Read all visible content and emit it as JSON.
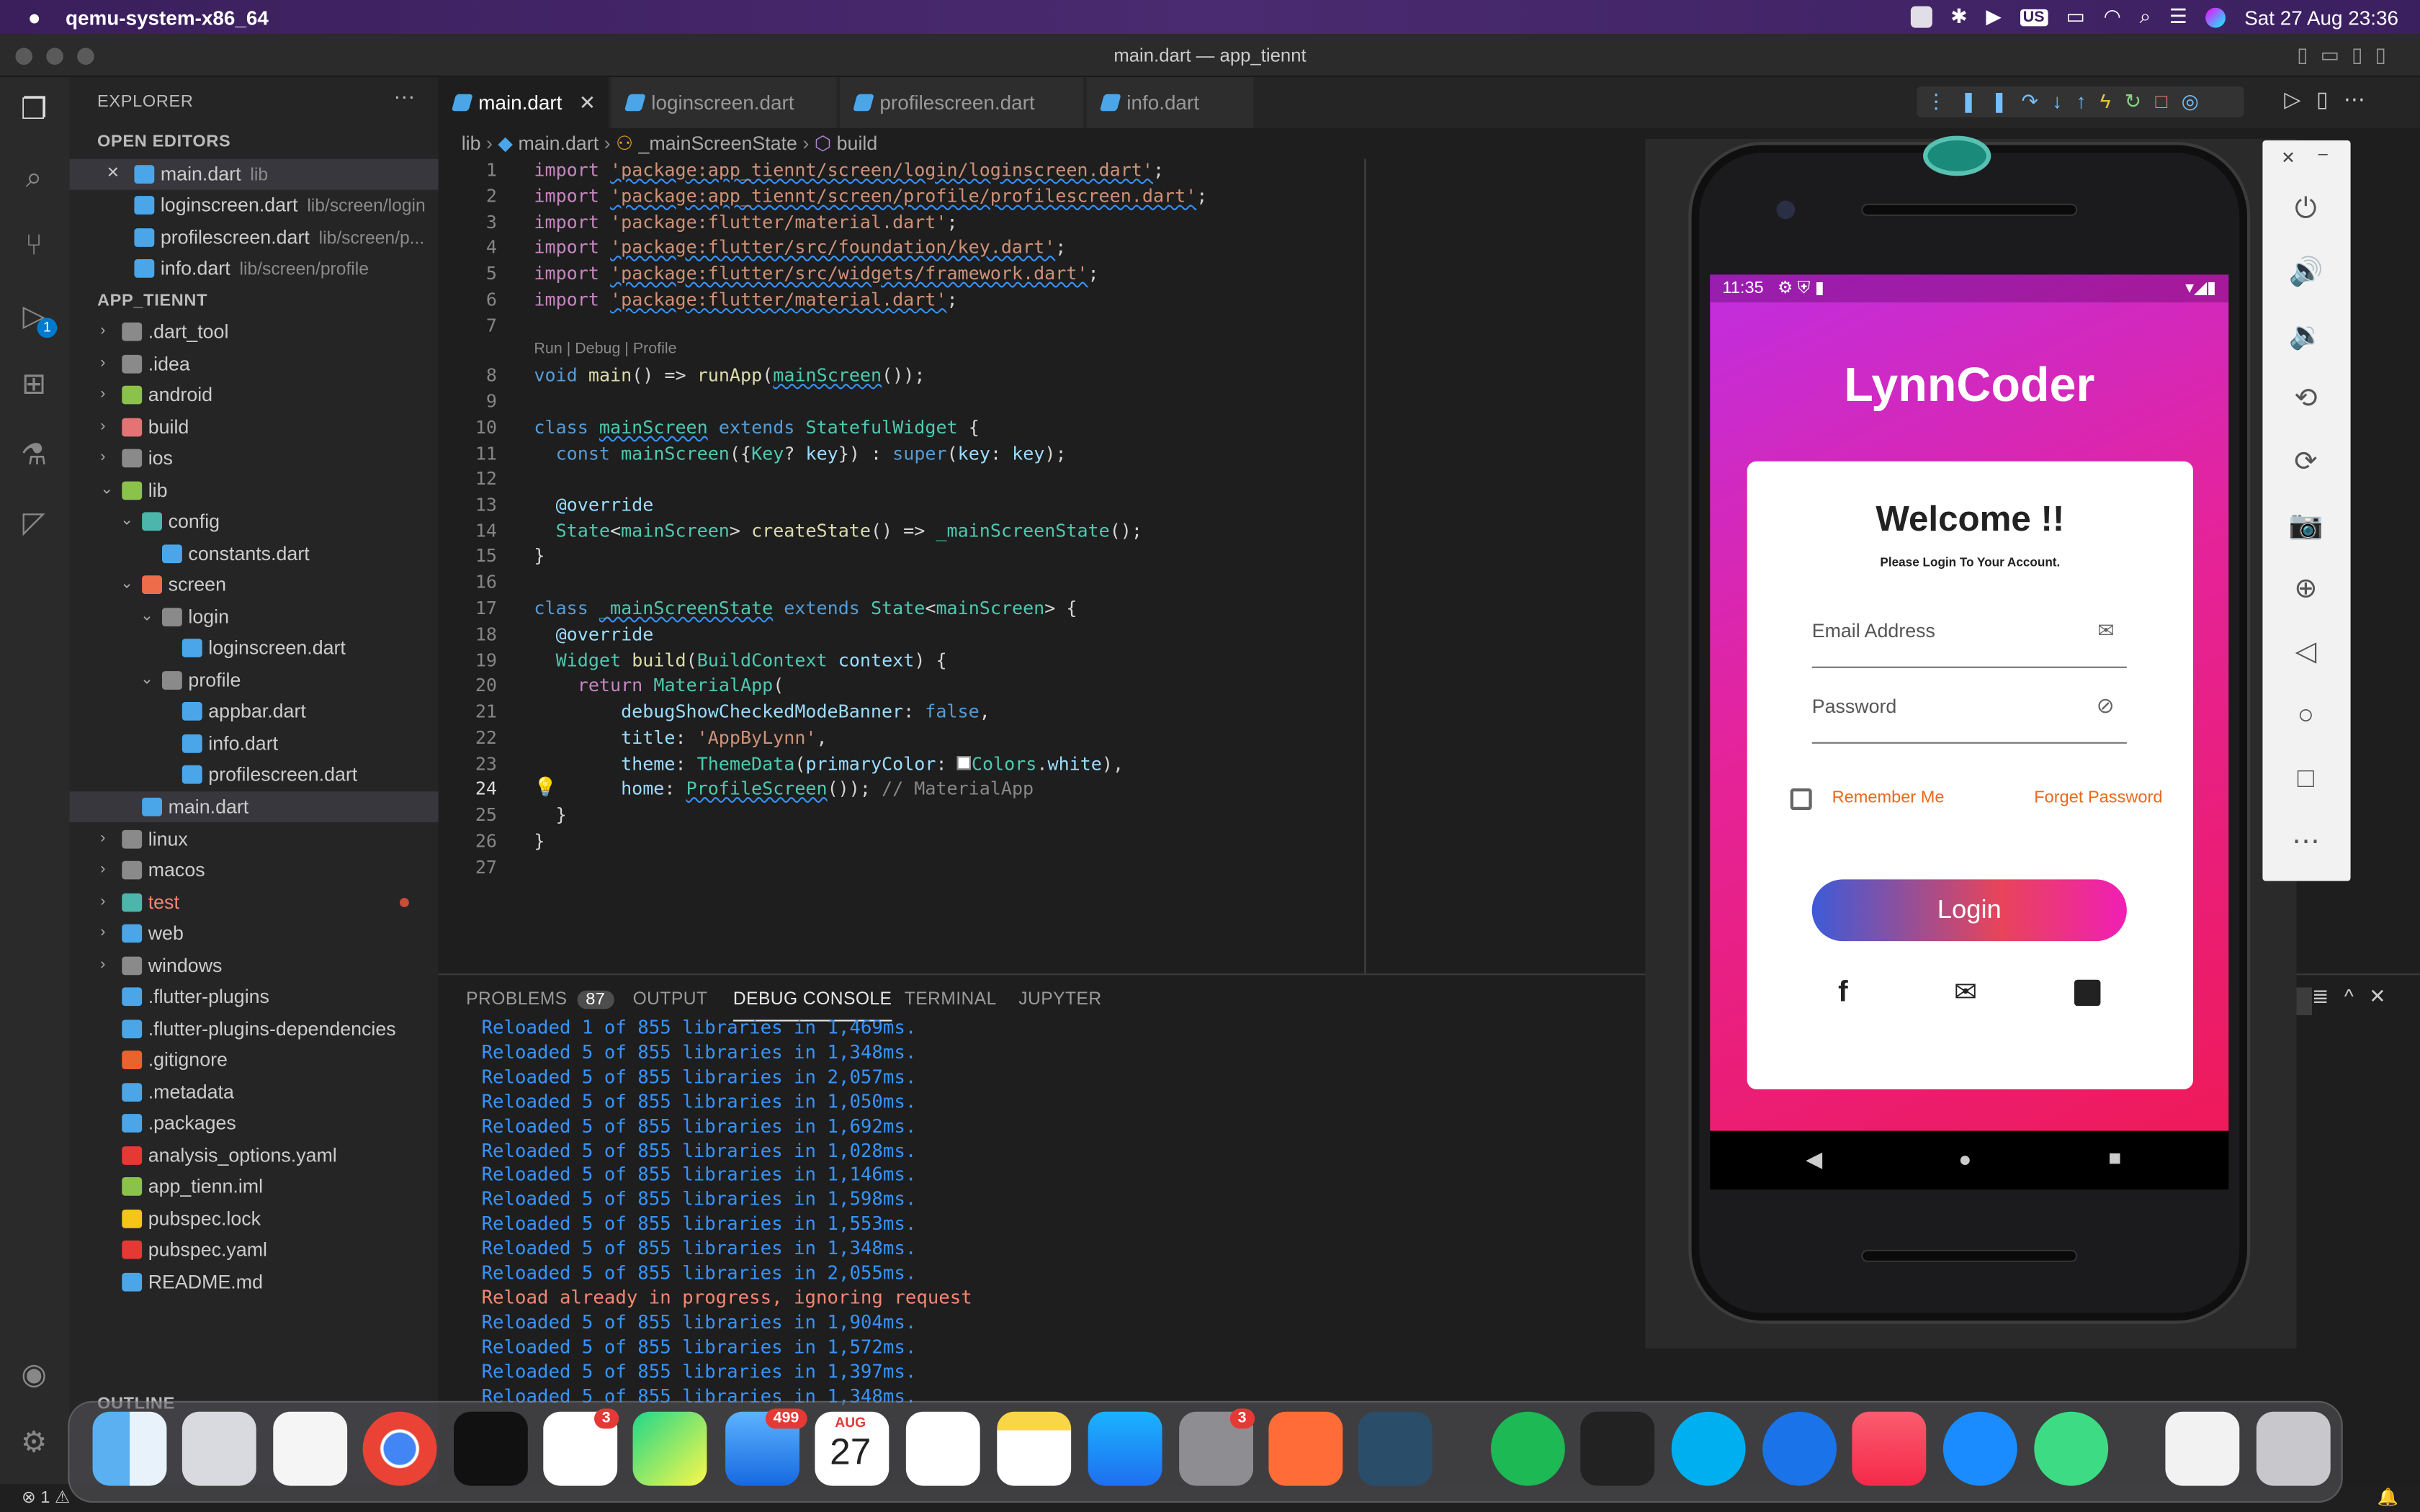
{
  "menubar": {
    "app_name": "qemu-system-x86_64",
    "datetime": "Sat 27 Aug  23:36",
    "input_source": "US"
  },
  "window": {
    "title": "main.dart — app_tiennt"
  },
  "explorer": {
    "title": "EXPLORER",
    "more": "···",
    "open_editors_header": "OPEN EDITORS",
    "open_editors": [
      {
        "name": "main.dart",
        "path": "lib"
      },
      {
        "name": "loginscreen.dart",
        "path": "lib/screen/login"
      },
      {
        "name": "profilescreen.dart",
        "path": "lib/screen/p..."
      },
      {
        "name": "info.dart",
        "path": "lib/screen/profile"
      }
    ],
    "project_header": "APP_TIENNT",
    "tree": [
      ".dart_tool",
      ".idea",
      "android",
      "build",
      "ios",
      "lib",
      "config",
      "constants.dart",
      "screen",
      "login",
      "loginscreen.dart",
      "profile",
      "appbar.dart",
      "info.dart",
      "profilescreen.dart",
      "main.dart",
      "linux",
      "macos",
      "test",
      "web",
      "windows",
      ".flutter-plugins",
      ".flutter-plugins-dependencies",
      ".gitignore",
      ".metadata",
      ".packages",
      "analysis_options.yaml",
      "app_tienn.iml",
      "pubspec.lock",
      "pubspec.yaml",
      "README.md"
    ],
    "outline_header": "OUTLINE"
  },
  "activity": {
    "debug_badge": "1"
  },
  "tabs": [
    "main.dart",
    "loginscreen.dart",
    "profilescreen.dart",
    "info.dart"
  ],
  "breadcrumb": {
    "folder": "lib",
    "file": "main.dart",
    "class": "_mainScreenState",
    "method": "build"
  },
  "code": {
    "codelens": "Run | Debug | Profile",
    "line_numbers": [
      "1",
      "2",
      "3",
      "4",
      "5",
      "6",
      "7",
      "8",
      "9",
      "10",
      "11",
      "12",
      "13",
      "14",
      "15",
      "16",
      "17",
      "18",
      "19",
      "20",
      "21",
      "22",
      "23",
      "24",
      "25",
      "26",
      "27"
    ],
    "imports": [
      "'package:app_tiennt/screen/login/loginscreen.dart'",
      "'package:app_tiennt/screen/profile/profilescreen.dart'",
      "'package:flutter/material.dart'",
      "'package:flutter/src/foundation/key.dart'",
      "'package:flutter/src/widgets/framework.dart'",
      "'package:flutter/material.dart'"
    ]
  },
  "panel": {
    "tabs": [
      "PROBLEMS",
      "OUTPUT",
      "DEBUG CONSOLE",
      "TERMINAL",
      "JUPYTER"
    ],
    "problems_count": "87",
    "log": [
      "Reloaded 1 of 855 libraries in 1,469ms.",
      "Reloaded 5 of 855 libraries in 1,348ms.",
      "Reloaded 5 of 855 libraries in 2,057ms.",
      "Reloaded 5 of 855 libraries in 1,050ms.",
      "Reloaded 5 of 855 libraries in 1,692ms.",
      "Reloaded 5 of 855 libraries in 1,028ms.",
      "Reloaded 5 of 855 libraries in 1,146ms.",
      "Reloaded 5 of 855 libraries in 1,598ms.",
      "Reloaded 5 of 855 libraries in 1,553ms.",
      "Reloaded 5 of 855 libraries in 1,348ms.",
      "Reloaded 5 of 855 libraries in 2,055ms.",
      "Reload already in progress, ignoring request",
      "Reloaded 5 of 855 libraries in 1,904ms.",
      "Reloaded 5 of 855 libraries in 1,572ms.",
      "Reloaded 5 of 855 libraries in 1,397ms.",
      "Reloaded 5 of 855 libraries in 1,348ms."
    ]
  },
  "status": {
    "left": "⊗ 1 ⚠"
  },
  "phone": {
    "time": "11:35",
    "app_title": "LynnCoder",
    "welcome": "Welcome !!",
    "subtitle": "Please Login To Your Account.",
    "email_placeholder": "Email Address",
    "password_placeholder": "Password",
    "remember_me": "Remember Me",
    "forget_password": "Forget Password",
    "login_button": "Login"
  },
  "dock": {
    "slack_badge": "3",
    "mail_badge": "499",
    "calendar_month": "AUG",
    "calendar_day": "27",
    "settings_badge": "3"
  },
  "colors": {
    "accent": "#007acc",
    "gradient_start": "#c02ee0",
    "gradient_end": "#ef1a5a",
    "orange_link": "#e8691c"
  }
}
